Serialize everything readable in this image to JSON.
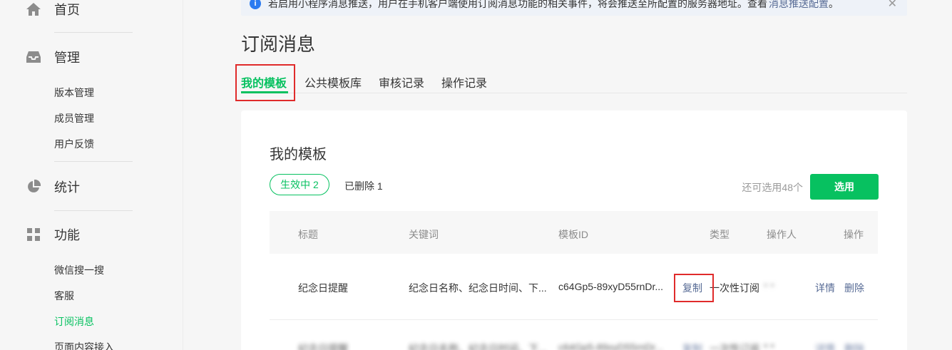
{
  "sidebar": {
    "home": "首页",
    "manage": "管理",
    "manage_items": [
      "版本管理",
      "成员管理",
      "用户反馈"
    ],
    "stats": "统计",
    "features": "功能",
    "feature_items": [
      "微信搜一搜",
      "客服",
      "订阅消息",
      "页面内容接入"
    ]
  },
  "banner": {
    "text": "若启用小程序消息推送，用户在手机客户端使用订阅消息功能的相关事件，将会推送至所配置的服务器地址。查看",
    "link": "消息推送配置",
    "suffix": "。"
  },
  "page_title": "订阅消息",
  "tabs": [
    "我的模板",
    "公共模板库",
    "审核记录",
    "操作记录"
  ],
  "card": {
    "title": "我的模板",
    "active_filter": "生效中  2",
    "deleted_filter": "已删除  1",
    "remaining": "还可选用48个",
    "select_button": "选用"
  },
  "table": {
    "headers": [
      "标题",
      "关键词",
      "模板ID",
      "类型",
      "操作人",
      "操作"
    ],
    "rows": [
      {
        "title": "纪念日提醒",
        "keywords": "纪念日名称、纪念日时间、下...",
        "template_id": "c64Gp5-89xyD55rnDr...",
        "copy": "复制",
        "type": "一次性订阅",
        "operator": "* *",
        "detail": "详情",
        "delete": "删除"
      },
      {
        "title": "纪念日提醒",
        "keywords": "纪念日名称、纪念日时间、下...",
        "template_id": "c64Gp5-89xyD55rnDr...",
        "copy": "复制",
        "type": "一次性订阅",
        "operator": "* *",
        "detail": "详情",
        "delete": "删除"
      }
    ]
  },
  "colors": {
    "accent": "#07c160",
    "link": "#576b95",
    "highlight": "#e02b2b"
  }
}
